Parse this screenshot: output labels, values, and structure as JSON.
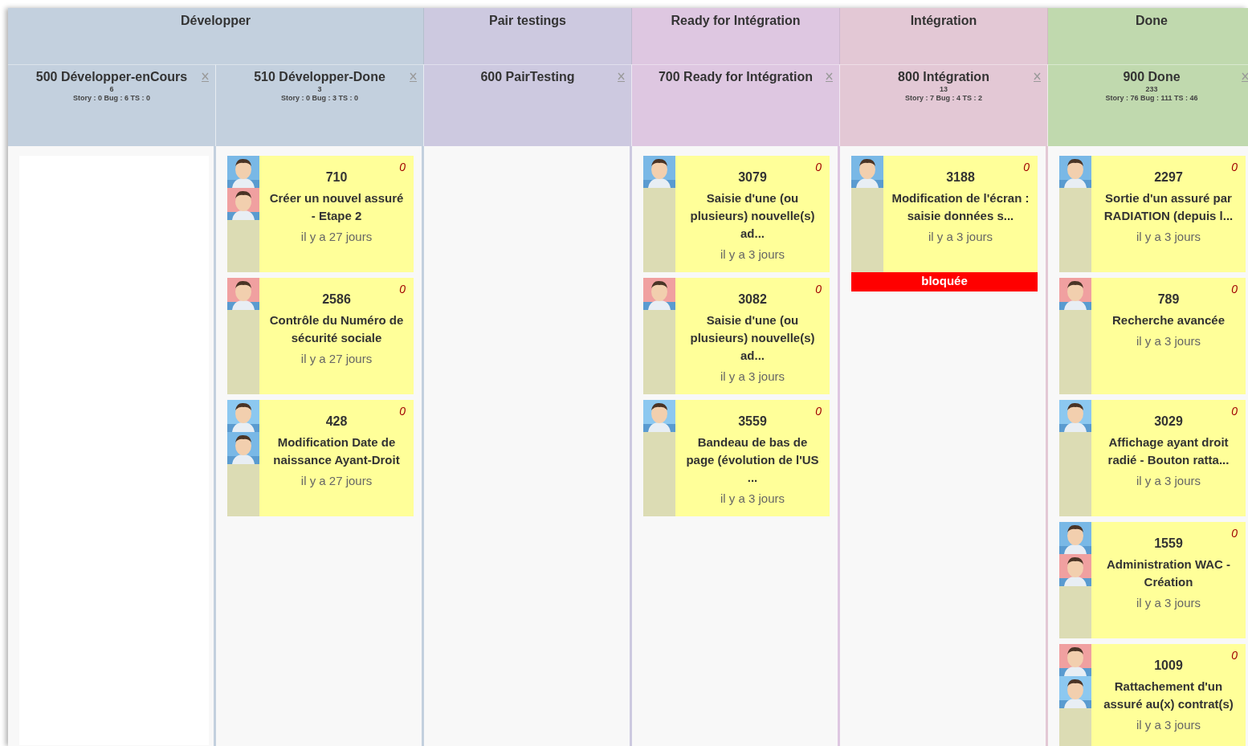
{
  "groups": [
    {
      "title": "Développer",
      "color": "#c3d0de",
      "columns": [
        {
          "title": "500 Développer-enCours",
          "count": "6",
          "stats": "Story : 0 Bug : 6 TS : 0",
          "empty_zone": true
        },
        {
          "title": "510 Développer-Done",
          "count": "3",
          "stats": "Story : 0 Bug : 3 TS : 0",
          "cards": [
            {
              "number": "710",
              "title": "Créer un nouvel assuré - Etape 2",
              "age": "il y a 27 jours",
              "points": "0",
              "blocked": false
            },
            {
              "number": "2586",
              "title": "Contrôle du Numéro de sécurité sociale",
              "age": "il y a 27 jours",
              "points": "0",
              "blocked": false
            },
            {
              "number": "428",
              "title": "Modification Date de naissance Ayant-Droit",
              "age": "il y a 27 jours",
              "points": "0",
              "blocked": false
            }
          ]
        }
      ]
    },
    {
      "title": "Pair testings",
      "color": "#cdc9e0",
      "columns": [
        {
          "title": "600 PairTesting"
        }
      ]
    },
    {
      "title": "Ready for Intégration",
      "color": "#dec7e1",
      "columns": [
        {
          "title": "700 Ready for Intégration",
          "cards": [
            {
              "number": "3079",
              "title": "Saisie d'une (ou plusieurs) nouvelle(s) ad...",
              "age": "il y a 3 jours",
              "points": "0",
              "blocked": false
            },
            {
              "number": "3082",
              "title": "Saisie d'une (ou plusieurs) nouvelle(s) ad...",
              "age": "il y a 3 jours",
              "points": "0",
              "blocked": false
            },
            {
              "number": "3559",
              "title": "Bandeau de bas de page (évolution de l'US ...",
              "age": "il y a 3 jours",
              "points": "0",
              "blocked": false
            }
          ]
        }
      ]
    },
    {
      "title": "Intégration",
      "color": "#e3c8d5",
      "columns": [
        {
          "title": "800 Intégration",
          "count": "13",
          "stats": "Story : 7 Bug : 4 TS : 2",
          "cards": [
            {
              "number": "3188",
              "title": "Modification de l'écran : saisie données s...",
              "age": "il y a 3 jours",
              "points": "0",
              "blocked": true,
              "blocked_label": "bloquée"
            }
          ]
        }
      ]
    },
    {
      "title": "Done",
      "color": "#c0d9ae",
      "columns": [
        {
          "title": "900 Done",
          "count": "233",
          "stats": "Story : 76 Bug : 111 TS : 46",
          "cards": [
            {
              "number": "2297",
              "title": "Sortie d'un assuré par RADIATION (depuis l...",
              "age": "il y a 3 jours",
              "points": "0",
              "blocked": false
            },
            {
              "number": "789",
              "title": "Recherche avancée",
              "age": "il y a 3 jours",
              "points": "0",
              "blocked": false
            },
            {
              "number": "3029",
              "title": "Affichage ayant droit radié - Bouton ratta...",
              "age": "il y a 3 jours",
              "points": "0",
              "blocked": false
            },
            {
              "number": "1559",
              "title": "Administration WAC - Création",
              "age": "il y a 3 jours",
              "points": "0",
              "blocked": false
            },
            {
              "number": "1009",
              "title": "Rattachement d'un assuré au(x) contrat(s)",
              "age": "il y a 3 jours",
              "points": "0",
              "blocked": false
            }
          ]
        }
      ]
    }
  ]
}
